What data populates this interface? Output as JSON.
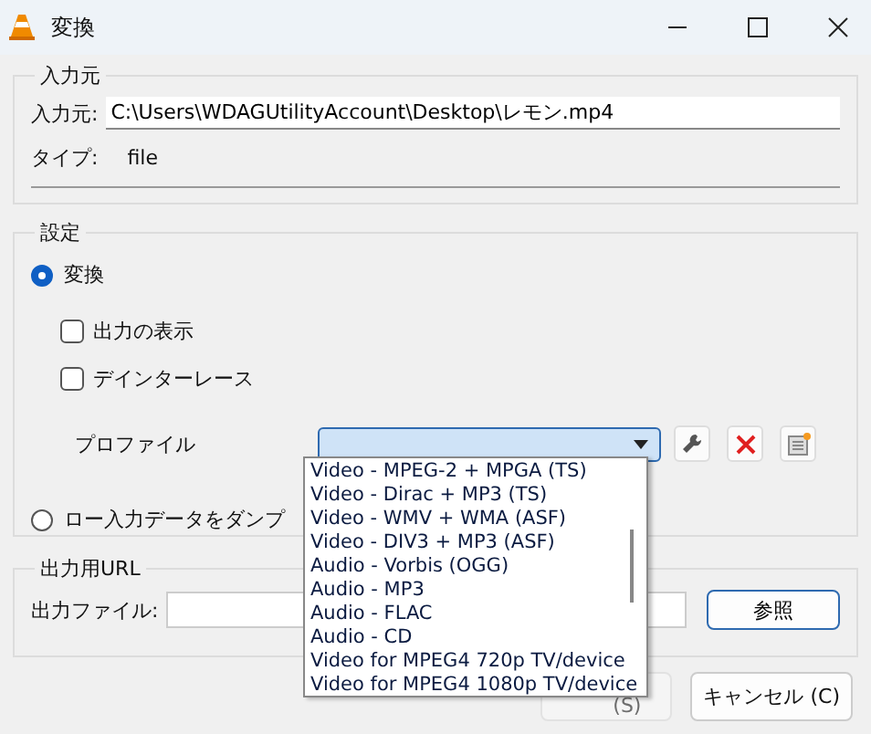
{
  "window": {
    "title": "変換"
  },
  "source": {
    "title": "入力元",
    "field_label": "入力元:",
    "field_value": "C:\\Users\\WDAGUtilityAccount\\Desktop\\レモン.mp4",
    "type_label": "タイプ:",
    "type_value": "file"
  },
  "settings": {
    "title": "設定",
    "modes": [
      {
        "label": "変換",
        "selected": true
      },
      {
        "label": "ロー入力データをダンプ",
        "selected": false
      }
    ],
    "checkboxes": [
      {
        "label": "出力の表示",
        "checked": false
      },
      {
        "label": "デインターレース",
        "checked": false
      }
    ],
    "profile_label": "プロファイル",
    "profile_list": [
      "Video - MPEG-2 + MPGA (TS)",
      "Video - Dirac + MP3 (TS)",
      "Video - WMV + WMA (ASF)",
      "Video - DIV3 + MP3 (ASF)",
      "Audio - Vorbis (OGG)",
      "Audio - MP3",
      "Audio - FLAC",
      "Audio - CD",
      "Video for MPEG4 720p TV/device",
      "Video for MPEG4 1080p TV/device"
    ]
  },
  "output": {
    "title": "出力用URL",
    "file_label": "出力ファイル:",
    "browse_button": "参照"
  },
  "buttons": [
    {
      "label": "(S)",
      "disabled": true
    },
    {
      "label": "キャンセル (C)",
      "disabled": false
    }
  ]
}
